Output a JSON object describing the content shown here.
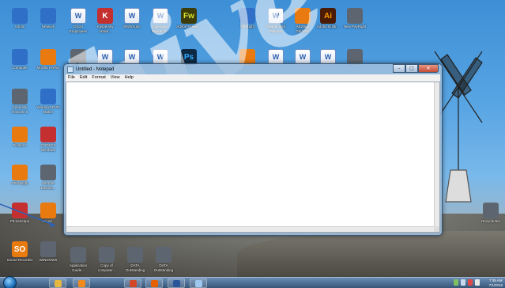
{
  "desktop": {
    "icons_row1": [
      {
        "label": "Admin",
        "glyph": "",
        "style": "g-blue"
      },
      {
        "label": "Network",
        "glyph": "",
        "style": "g-blue"
      },
      {
        "label": "Ghost Employees",
        "glyph": "W",
        "style": "g-word"
      },
      {
        "label": "Kaspersky Antivir...",
        "glyph": "K",
        "style": "g-red"
      },
      {
        "label": "MSWSubs",
        "glyph": "W",
        "style": "g-word"
      },
      {
        "label": "Operation Report fo...",
        "glyph": "W",
        "style": "g-word"
      },
      {
        "label": "Adobe Firewo...",
        "glyph": "Fw",
        "style": "g-fw"
      },
      {
        "label": "FileRight",
        "glyph": "",
        "style": "g-blue"
      },
      {
        "label": "Glenda Visit Pictures",
        "glyph": "W",
        "style": "g-word"
      },
      {
        "label": "A&W&G GRAPHI",
        "glyph": "",
        "style": "g-orange"
      },
      {
        "label": "Adobe Illustr...",
        "glyph": "Ai",
        "style": "g-ai"
      },
      {
        "label": "New PayRight",
        "glyph": "",
        "style": "g-gray"
      }
    ],
    "icons_row2": [
      {
        "label": "Computer",
        "glyph": "",
        "style": "g-blue"
      },
      {
        "label": "Mozilla Firefox",
        "glyph": "",
        "style": "g-orange"
      },
      {
        "label": "",
        "glyph": "",
        "style": "g-gray"
      },
      {
        "label": "",
        "glyph": "W",
        "style": "g-word"
      },
      {
        "label": "",
        "glyph": "W",
        "style": "g-word"
      },
      {
        "label": "",
        "glyph": "W",
        "style": "g-word"
      },
      {
        "label": "",
        "glyph": "Ps",
        "style": "g-ps"
      },
      {
        "label": "",
        "glyph": "",
        "style": "g-orange"
      },
      {
        "label": "",
        "glyph": "W",
        "style": "g-word"
      },
      {
        "label": "",
        "glyph": "W",
        "style": "g-word"
      },
      {
        "label": "",
        "glyph": "W",
        "style": "g-word"
      },
      {
        "label": "",
        "glyph": "",
        "style": "g-gray"
      }
    ],
    "icons_left": [
      {
        "label": "Cyberlink YouCam 5",
        "glyph": "",
        "style": "g-gray"
      },
      {
        "label": "Picasa 3",
        "glyph": "",
        "style": "g-orange"
      },
      {
        "label": "VPN Right",
        "glyph": "",
        "style": "g-orange"
      },
      {
        "label": "PhotoScape",
        "glyph": "",
        "style": "g-red"
      },
      {
        "label": "Sound Recorder",
        "glyph": "SO",
        "style": "g-orange"
      }
    ],
    "icons_left2": [
      {
        "label": "Windows DVD Maker",
        "glyph": "",
        "style": "g-blue"
      },
      {
        "label": "CODECS Windows",
        "glyph": "",
        "style": "g-red"
      },
      {
        "label": "Internet Downlo...",
        "glyph": "",
        "style": "g-gray"
      },
      {
        "label": "Sound...",
        "glyph": "",
        "style": "g-orange"
      },
      {
        "label": "WINDOWS",
        "glyph": "",
        "style": "g-gray"
      }
    ],
    "icons_bottom": [
      {
        "label": "Application Guide...",
        "glyph": "",
        "style": "g-gray"
      },
      {
        "label": "Copy of computer...",
        "glyph": "",
        "style": "g-gray"
      },
      {
        "label": "DATA Outstanding",
        "glyph": "",
        "style": "g-gray"
      },
      {
        "label": "DATA Outstanding",
        "glyph": "",
        "style": "g-gray"
      }
    ],
    "recycle_bin": {
      "label": "Recycle Bin",
      "glyph": "",
      "style": "g-gray"
    },
    "watermark": "hive"
  },
  "notepad": {
    "title": "Untitled - Notepad",
    "menu": [
      "File",
      "Edit",
      "Format",
      "View",
      "Help"
    ],
    "minimize": "–",
    "maximize": "□",
    "close": "✕",
    "content": ""
  },
  "taskbar": {
    "buttons": [
      {
        "name": "explorer-button",
        "color": "#e6b840"
      },
      {
        "name": "media-player-button",
        "color": "#f08a1c"
      },
      {
        "name": "powerpoint-button",
        "color": "#d24726"
      },
      {
        "name": "firefox-button",
        "color": "#e66000"
      },
      {
        "name": "word-button",
        "color": "#2b579a"
      },
      {
        "name": "notepad-button",
        "color": "#9ec8ef"
      }
    ],
    "clock_time": "7:39 AM",
    "clock_date": "7/1/2016"
  }
}
